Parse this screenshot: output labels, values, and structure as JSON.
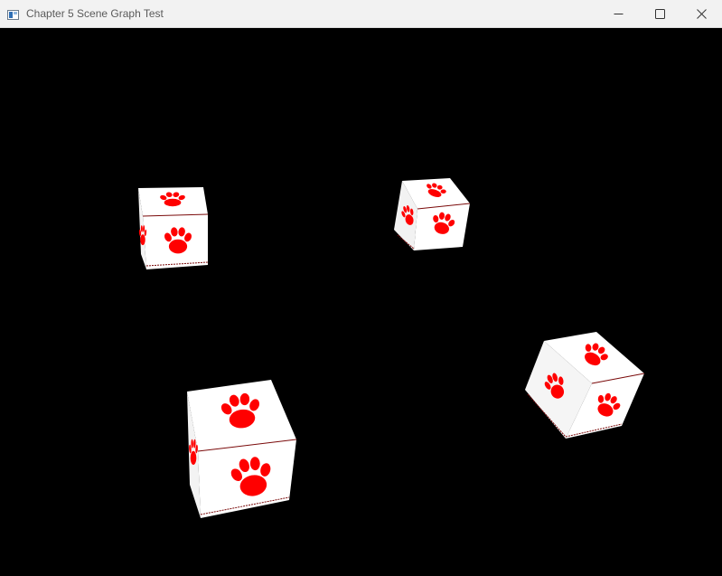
{
  "window": {
    "title": "Chapter 5 Scene Graph Test",
    "controls": {
      "minimize": "minimize-icon",
      "maximize": "maximize-icon",
      "close": "close-icon"
    }
  },
  "scene": {
    "background_color": "#000000",
    "die_face_color": "#ffffff",
    "paw_color": "#ff0000",
    "die_count": 4,
    "die_icon": "paw-print-icon"
  }
}
